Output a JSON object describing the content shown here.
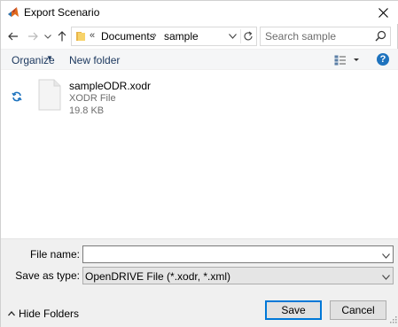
{
  "window": {
    "title": "Export Scenario",
    "app_icon": "matlab-icon",
    "close_icon": "close-icon"
  },
  "nav": {
    "back_icon": "arrow-left-icon",
    "forward_icon": "arrow-right-icon",
    "recent_icon": "chevron-down-icon",
    "up_icon": "arrow-up-icon",
    "address": {
      "separator": "«",
      "crumbs": [
        "Documents",
        "sample"
      ],
      "crumb_separator": "›"
    },
    "search_placeholder": "Search sample"
  },
  "toolbar": {
    "organize_label": "Organize",
    "new_folder_label": "New folder",
    "help_label": "?"
  },
  "content": {
    "files": [
      {
        "name": "sampleODR.xodr",
        "type": "XODR File",
        "size": "19.8 KB"
      }
    ]
  },
  "fields": {
    "file_name_label": "File name:",
    "file_name_value": "",
    "save_as_type_label": "Save as type:",
    "save_as_type_value": "OpenDRIVE File (*.xodr, *.xml)"
  },
  "footer": {
    "hide_folders_label": "Hide Folders",
    "save_label": "Save",
    "cancel_label": "Cancel"
  },
  "colors": {
    "accent": "#0078d7",
    "help": "#1e73be",
    "link_text": "#1e3a60",
    "sync_icon": "#1e73be"
  }
}
